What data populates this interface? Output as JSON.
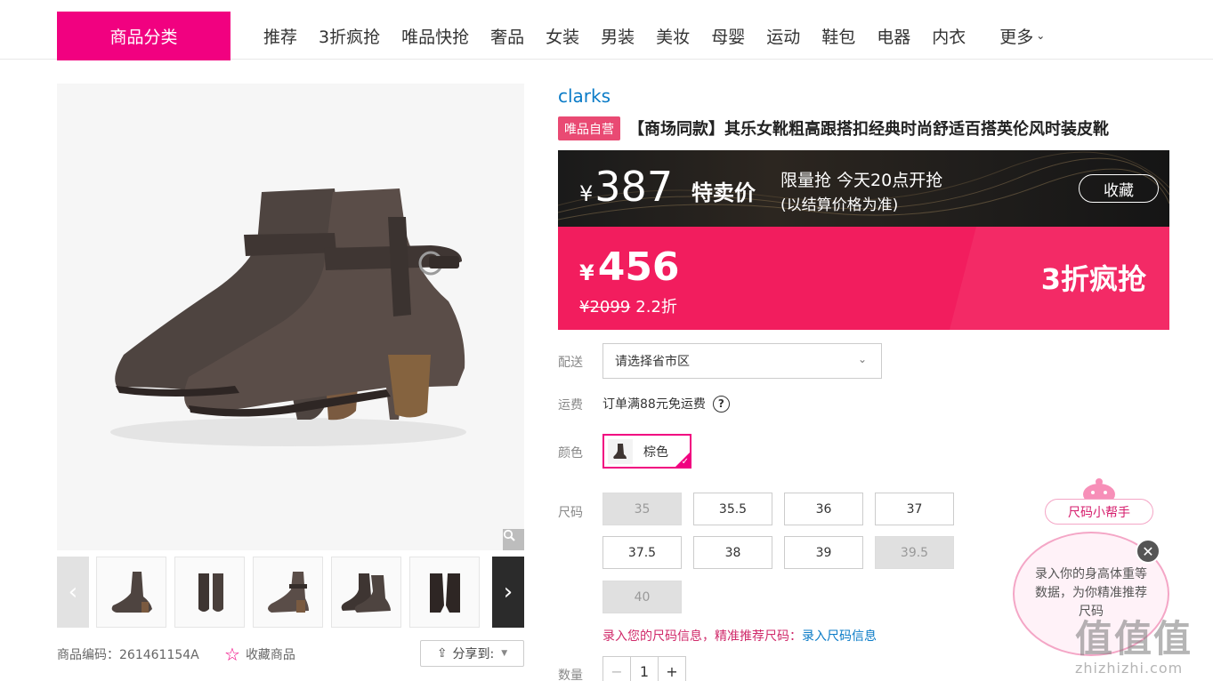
{
  "nav": {
    "category_button": "商品分类",
    "items": [
      "推荐",
      "3折疯抢",
      "唯品快抢",
      "奢品",
      "女装",
      "男装",
      "美妆",
      "母婴",
      "运动",
      "鞋包",
      "电器",
      "内衣"
    ],
    "more": "更多"
  },
  "gallery": {
    "thumb_count": 5,
    "sku_label": "商品编码：261461154A",
    "favorite": "收藏商品",
    "share": "分享到:"
  },
  "product": {
    "brand": "clarks",
    "self_badge": "唯品自营",
    "title": "【商场同款】其乐女靴粗高跟搭扣经典时尚舒适百搭英伦风时装皮靴"
  },
  "pricing": {
    "currency": "¥",
    "special_price": "387",
    "special_label": "特卖价",
    "flash_line1": "限量抢 今天20点开抢",
    "flash_line2": "(以结算价格为准)",
    "collect": "收藏",
    "vip_price": "456",
    "original_price": "¥2099",
    "discount": "2.2折",
    "promo": "3折疯抢"
  },
  "delivery": {
    "label": "配送",
    "placeholder": "请选择省市区"
  },
  "freight": {
    "label": "运费",
    "text": "订单满88元免运费"
  },
  "color": {
    "label": "颜色",
    "selected": "棕色"
  },
  "sizes": {
    "label": "尺码",
    "options": [
      {
        "value": "35",
        "available": false
      },
      {
        "value": "35.5",
        "available": true
      },
      {
        "value": "36",
        "available": true
      },
      {
        "value": "37",
        "available": true
      },
      {
        "value": "37.5",
        "available": true
      },
      {
        "value": "38",
        "available": true
      },
      {
        "value": "39",
        "available": true
      },
      {
        "value": "39.5",
        "available": false
      },
      {
        "value": "40",
        "available": false
      }
    ],
    "hint": "录入您的尺码信息，精准推荐尺码：",
    "hint_link": "录入尺码信息"
  },
  "quantity": {
    "label": "数量",
    "value": "1",
    "minus": "−",
    "plus": "+"
  },
  "size_helper": {
    "title": "尺码小帮手",
    "message": "录入你的身高体重等数据，为你精准推荐尺码"
  },
  "watermark": {
    "big": "值值值",
    "small": "zhizhizhi.com"
  },
  "colors": {
    "accent": "#f10180",
    "price_pink": "#f21d5e",
    "brand_link": "#0a7bc7"
  }
}
